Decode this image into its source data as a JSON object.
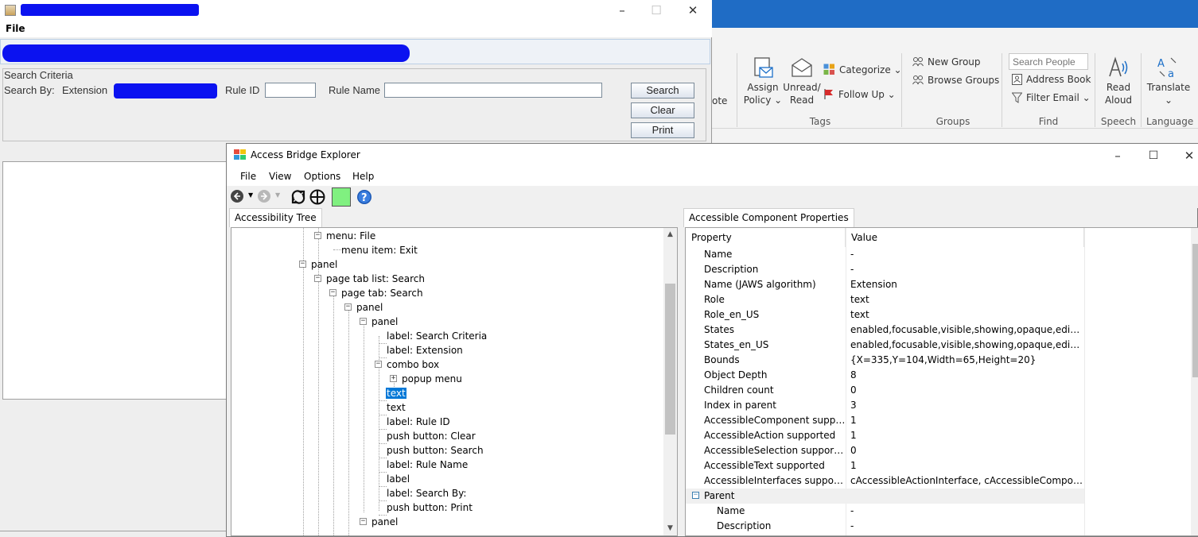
{
  "outlook": {
    "partial_label": "ote",
    "buttons": {
      "assign_policy_line1": "Assign",
      "assign_policy_line2": "Policy ⌄",
      "unread_read_line1": "Unread/",
      "unread_read_line2": "Read",
      "categorize": "Categorize ⌄",
      "follow_up": "Follow Up ⌄",
      "new_group": "New Group",
      "browse_groups": "Browse Groups",
      "search_people_placeholder": "Search People",
      "address_book": "Address Book",
      "filter_email": "Filter Email ⌄",
      "read_aloud_line1": "Read",
      "read_aloud_line2": "Aloud",
      "translate": "Translate",
      "translate_caret": "⌄"
    },
    "groups": {
      "tags": "Tags",
      "groups": "Groups",
      "find": "Find",
      "speech": "Speech",
      "language": "Language"
    },
    "colors": {
      "titlebar": "#1f6cc5",
      "ribbon": "#f3f3f3"
    }
  },
  "java_app": {
    "menu": {
      "file": "File"
    },
    "criteria": {
      "legend": "Search Criteria",
      "search_by": "Search By:",
      "extension_label": "Extension",
      "rule_id_label": "Rule ID",
      "rule_name_label": "Rule Name",
      "buttons": {
        "search": "Search",
        "clear": "Clear",
        "print": "Print"
      }
    },
    "redaction_color": "#0b12f0"
  },
  "abe": {
    "title": "Access Bridge Explorer",
    "menu": [
      "File",
      "View",
      "Options",
      "Help"
    ],
    "tabs": {
      "tree": "Accessibility Tree",
      "props": "Accessible Component Properties"
    },
    "tree": [
      {
        "label": "menu: File"
      },
      {
        "label": "menu item: Exit"
      },
      {
        "label": "panel"
      },
      {
        "label": "page tab list: Search"
      },
      {
        "label": "page tab: Search"
      },
      {
        "label": "panel"
      },
      {
        "label": "panel"
      },
      {
        "label": "label: Search Criteria"
      },
      {
        "label": "label: Extension"
      },
      {
        "label": "combo box"
      },
      {
        "label": "popup menu"
      },
      {
        "label": "text",
        "selected": true
      },
      {
        "label": "text"
      },
      {
        "label": "label: Rule ID"
      },
      {
        "label": "push button: Clear"
      },
      {
        "label": "push button: Search"
      },
      {
        "label": "label: Rule Name"
      },
      {
        "label": "label"
      },
      {
        "label": "label: Search By:"
      },
      {
        "label": "push button: Print"
      },
      {
        "label": "panel"
      },
      {
        "label": "..."
      }
    ],
    "props": {
      "headers": {
        "property": "Property",
        "value": "Value"
      },
      "rows": [
        {
          "name": "Name",
          "value": "-"
        },
        {
          "name": "Description",
          "value": "-"
        },
        {
          "name": "Name (JAWS algorithm)",
          "value": "Extension"
        },
        {
          "name": "Role",
          "value": "text"
        },
        {
          "name": "Role_en_US",
          "value": "text"
        },
        {
          "name": "States",
          "value": "enabled,focusable,visible,showing,opaque,editable..."
        },
        {
          "name": "States_en_US",
          "value": "enabled,focusable,visible,showing,opaque,editable..."
        },
        {
          "name": "Bounds",
          "value": "{X=335,Y=104,Width=65,Height=20}"
        },
        {
          "name": "Object Depth",
          "value": "8"
        },
        {
          "name": "Children count",
          "value": "0"
        },
        {
          "name": "Index in parent",
          "value": "3"
        },
        {
          "name": "AccessibleComponent suppor...",
          "value": "1"
        },
        {
          "name": "AccessibleAction supported",
          "value": "1"
        },
        {
          "name": "AccessibleSelection supported",
          "value": "0"
        },
        {
          "name": "AccessibleText supported",
          "value": "1"
        },
        {
          "name": "AccessibleInterfaces supported",
          "value": "cAccessibleActionInterface, cAccessibleComponen..."
        },
        {
          "name": "Parent",
          "value": "",
          "group": true,
          "expander": "−"
        },
        {
          "name": "Name",
          "value": "-",
          "child": true
        },
        {
          "name": "Description",
          "value": "-",
          "child": true
        }
      ]
    }
  }
}
